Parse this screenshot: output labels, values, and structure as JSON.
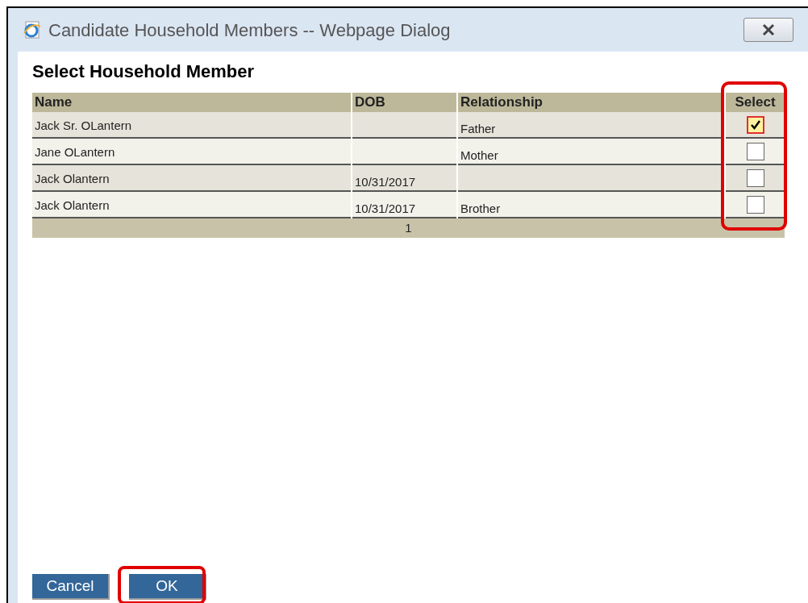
{
  "window": {
    "title": "Candidate Household Members -- Webpage Dialog"
  },
  "heading": "Select Household Member",
  "table": {
    "columns": [
      "Name",
      "DOB",
      "Relationship",
      "Select"
    ],
    "rows": [
      {
        "name": "Jack Sr. OLantern",
        "dob": "",
        "relationship": "Father",
        "checked": true
      },
      {
        "name": "Jane OLantern",
        "dob": "",
        "relationship": "Mother",
        "checked": false
      },
      {
        "name": "Jack Olantern",
        "dob": "10/31/2017",
        "relationship": "",
        "checked": false
      },
      {
        "name": "Jack Olantern",
        "dob": "10/31/2017",
        "relationship": "Brother",
        "checked": false
      }
    ],
    "pager": "1"
  },
  "buttons": [
    "Cancel",
    "OK"
  ]
}
